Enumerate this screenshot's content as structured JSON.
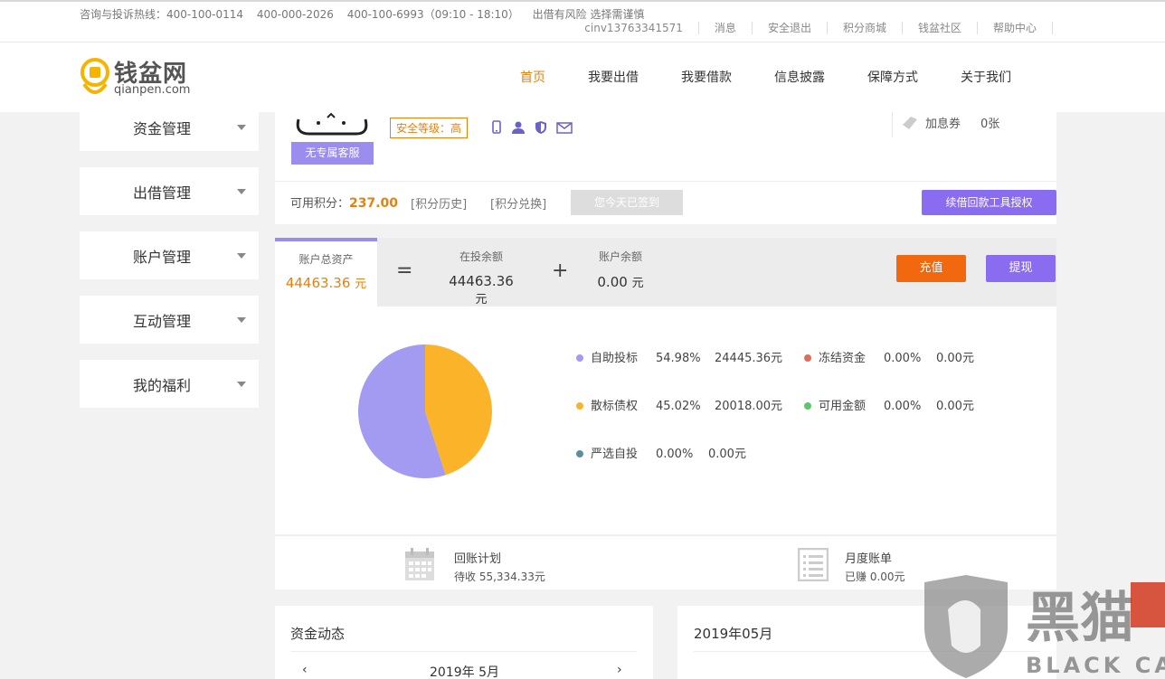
{
  "topbar": {
    "hotline_label": "咨询与投诉热线：400-100-0114",
    "phone2": "400-000-2026",
    "phone3": "400-100-6993（09:10 - 18:10）",
    "risk": "出借有风险 选择需谨慎",
    "links": [
      "cinv13763341571",
      "消息",
      "安全退出",
      "积分商城",
      "钱盆社区",
      "帮助中心"
    ]
  },
  "logo": {
    "cn": "钱盆网",
    "en": "qianpen.com"
  },
  "nav": {
    "items": [
      "首页",
      "我要出借",
      "我要借款",
      "信息披露",
      "保障方式",
      "关于我们"
    ],
    "active": 0
  },
  "sidebar": {
    "items": [
      "资金管理",
      "出借管理",
      "账户管理",
      "互动管理",
      "我的福利"
    ]
  },
  "profile": {
    "no_cs": "无专属客服",
    "security_level": "安全等级：高",
    "coupon_label": "加息券",
    "coupon_count": "0张",
    "points_label": "可用积分：",
    "points_value": "237.00",
    "points_history": "[积分历史]",
    "points_exchange": "[积分兑换]",
    "signed_today": "您今天已签到",
    "auth_button": "续借回款工具授权"
  },
  "assets": {
    "total_label": "账户总资产",
    "total_value": "44463.36",
    "invested_label": "在投余额",
    "invested_value": "44463.36",
    "balance_label": "账户余额",
    "balance_value": "0.00",
    "unit": "元",
    "eq": "=",
    "plus": "+",
    "recharge": "充值",
    "withdraw": "提现"
  },
  "chart_data": {
    "type": "pie",
    "slices": [
      {
        "name": "自助投标",
        "pct": "54.98%",
        "amount": "24445.36元",
        "value": 54.98,
        "color": "#a39bf2"
      },
      {
        "name": "散标债权",
        "pct": "45.02%",
        "amount": "20018.00元",
        "value": 45.02,
        "color": "#fbb42a"
      },
      {
        "name": "严选自投",
        "pct": "0.00%",
        "amount": "0.00元",
        "value": 0,
        "color": "#5d8ea0"
      },
      {
        "name": "冻结资金",
        "pct": "0.00%",
        "amount": "0.00元",
        "value": 0,
        "color": "#e36b5e"
      },
      {
        "name": "可用金额",
        "pct": "0.00%",
        "amount": "0.00元",
        "value": 0,
        "color": "#5cc86a"
      }
    ]
  },
  "plans": {
    "repay_title": "回账计划",
    "repay_sub": "待收 55,334.33元",
    "bill_title": "月度账单",
    "bill_sub": "已赚 0.00元"
  },
  "flow": {
    "title": "资金动态",
    "month": "2019年 5月",
    "prev": "‹",
    "next": "›"
  },
  "bill_panel": {
    "title": "2019年05月"
  },
  "watermark": {
    "text": "黑猫",
    "en": "BLACK CAT"
  }
}
